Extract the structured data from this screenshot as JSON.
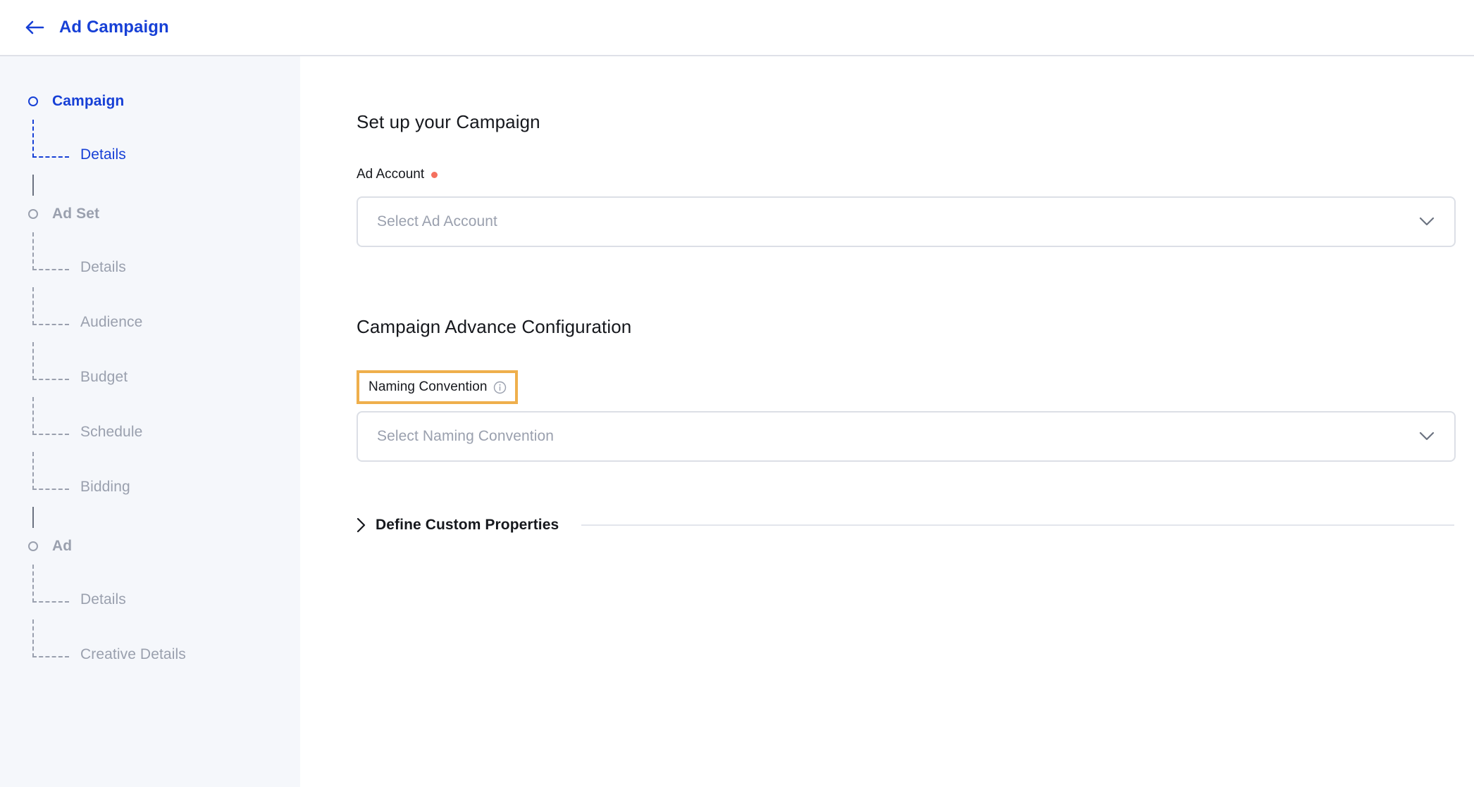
{
  "header": {
    "back_icon": "arrow-left-icon",
    "title": "Ad Campaign"
  },
  "sidebar": {
    "groups": [
      {
        "label": "Campaign",
        "active": true,
        "marker": "circle-outline-icon",
        "children": [
          {
            "label": "Details"
          }
        ]
      },
      {
        "label": "Ad Set",
        "active": false,
        "marker": "circle-outline-icon",
        "children": [
          {
            "label": "Details"
          },
          {
            "label": "Audience"
          },
          {
            "label": "Budget"
          },
          {
            "label": "Schedule"
          },
          {
            "label": "Bidding"
          }
        ]
      },
      {
        "label": "Ad",
        "active": false,
        "marker": "circle-outline-icon",
        "children": [
          {
            "label": "Details"
          },
          {
            "label": "Creative Details"
          }
        ]
      }
    ]
  },
  "main": {
    "setup_section": {
      "title": "Set up your Campaign",
      "ad_account": {
        "label": "Ad Account",
        "required": true,
        "placeholder": "Select Ad Account",
        "value": "",
        "dropdown_icon": "chevron-down-icon"
      }
    },
    "advance_section": {
      "title": "Campaign Advance Configuration",
      "naming_convention": {
        "label": "Naming Convention",
        "info_icon": "info-circle-icon",
        "highlighted": true,
        "placeholder": "Select Naming Convention",
        "value": "",
        "dropdown_icon": "chevron-down-icon"
      }
    },
    "custom_properties": {
      "label": "Define Custom Properties",
      "expand_icon": "chevron-right-icon",
      "expanded": false
    }
  },
  "colors": {
    "accent_blue": "#1740d6",
    "highlight_orange": "#efaf4c",
    "required_red": "#f4705e",
    "muted_gray": "#9aa0ae",
    "sidebar_bg": "#f5f7fb",
    "border_gray": "#dcdfe6"
  }
}
